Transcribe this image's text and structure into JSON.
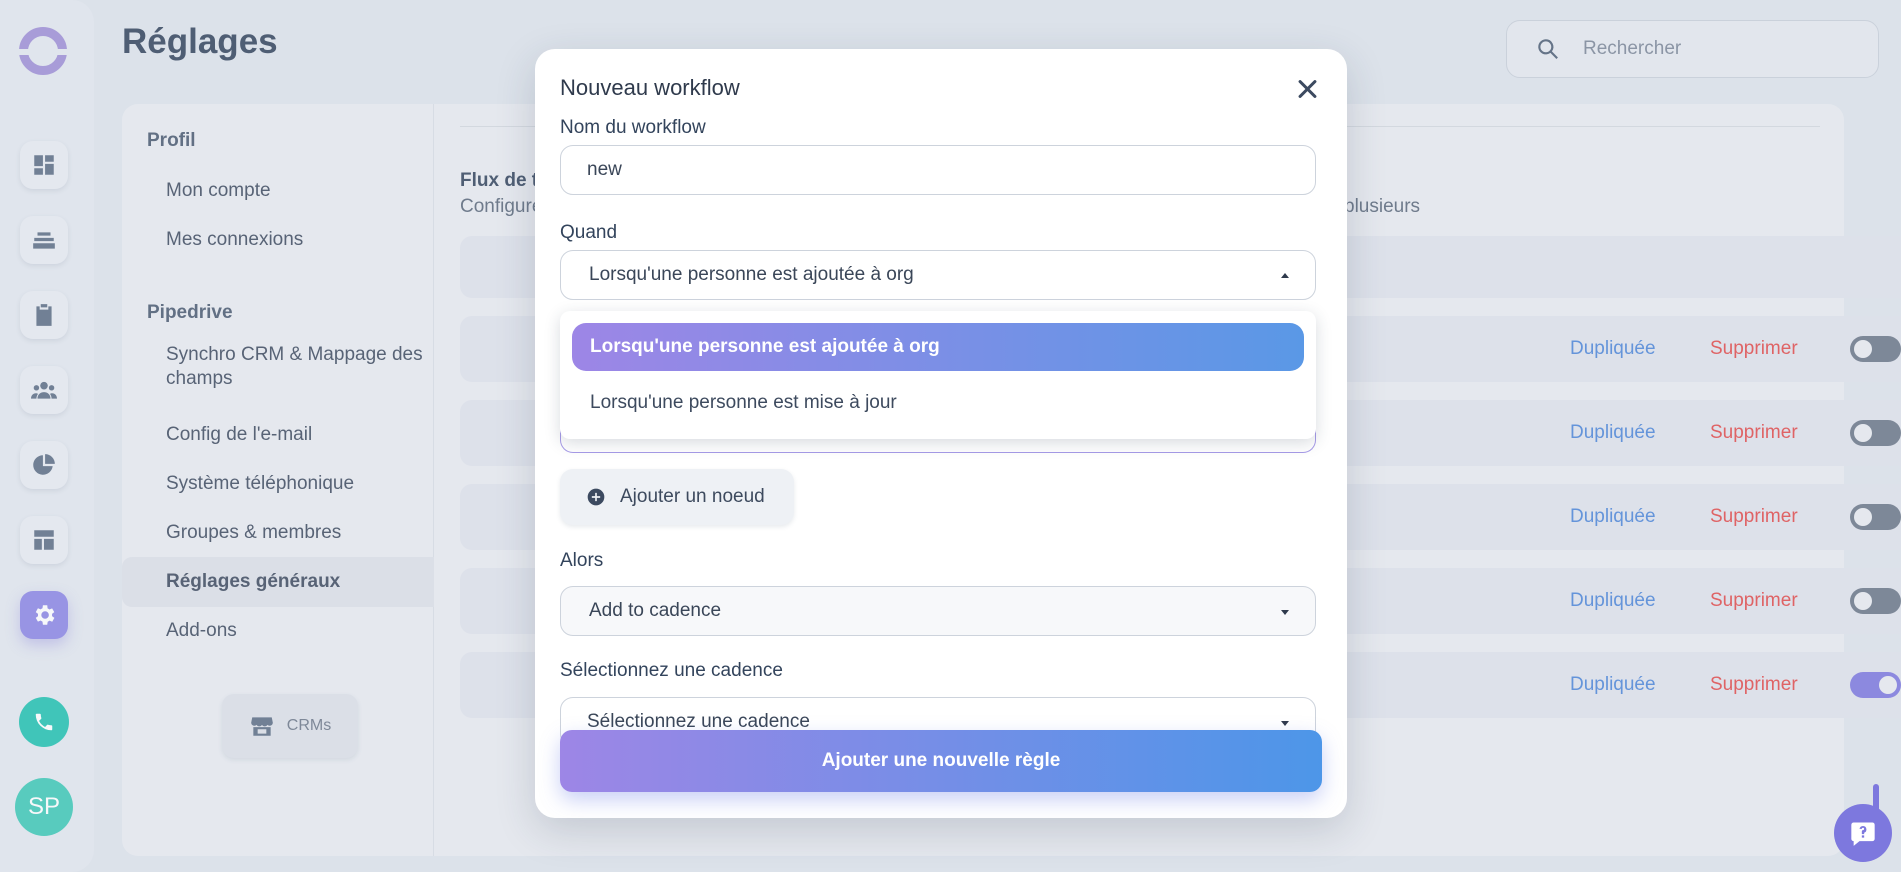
{
  "page": {
    "title": "Réglages"
  },
  "search": {
    "placeholder": "Rechercher"
  },
  "rail": {
    "avatar_initials": "SP"
  },
  "subnav": {
    "groups": [
      {
        "heading": "Profil",
        "items": [
          "Mon compte",
          "Mes connexions"
        ]
      },
      {
        "heading": "Pipedrive",
        "items": [
          "Synchro CRM & Mappage des champs",
          "Config de l'e-mail",
          "Système téléphonique",
          "Groupes & membres",
          "Réglages généraux",
          "Add-ons"
        ]
      }
    ],
    "active_item": "Réglages généraux",
    "crms_label": "CRMs"
  },
  "content": {
    "flow_title": "Flux de tr",
    "flow_desc": "Configure",
    "flow_desc_right": "plusieurs",
    "rows": [
      {
        "dup": "Dupliquée",
        "del": "Supprimer",
        "enabled": false
      },
      {
        "dup": "Dupliquée",
        "del": "Supprimer",
        "enabled": false
      },
      {
        "dup": "Dupliquée",
        "del": "Supprimer",
        "enabled": false
      },
      {
        "dup": "Dupliquée",
        "del": "Supprimer",
        "enabled": false
      },
      {
        "dup": "Dupliquée",
        "del": "Supprimer",
        "enabled": true
      }
    ]
  },
  "modal": {
    "title": "Nouveau workflow",
    "name_label": "Nom du workflow",
    "name_value": "new",
    "when_label": "Quand",
    "when_value": "Lorsqu'une personne est ajoutée à org",
    "when_options": [
      "Lorsqu'une personne est ajoutée à org",
      "Lorsqu'une personne est mise à jour"
    ],
    "add_node": "Ajouter un noeud",
    "then_label": "Alors",
    "then_value": "Add to cadence",
    "cadence_label": "Sélectionnez une cadence",
    "cadence_placeholder": "Sélectionnez une cadence",
    "submit": "Ajouter une nouvelle règle"
  },
  "colors": {
    "accent": "#7d78de",
    "danger": "#e24a4a",
    "link": "#4c86d8",
    "phone": "#20c1b0"
  }
}
